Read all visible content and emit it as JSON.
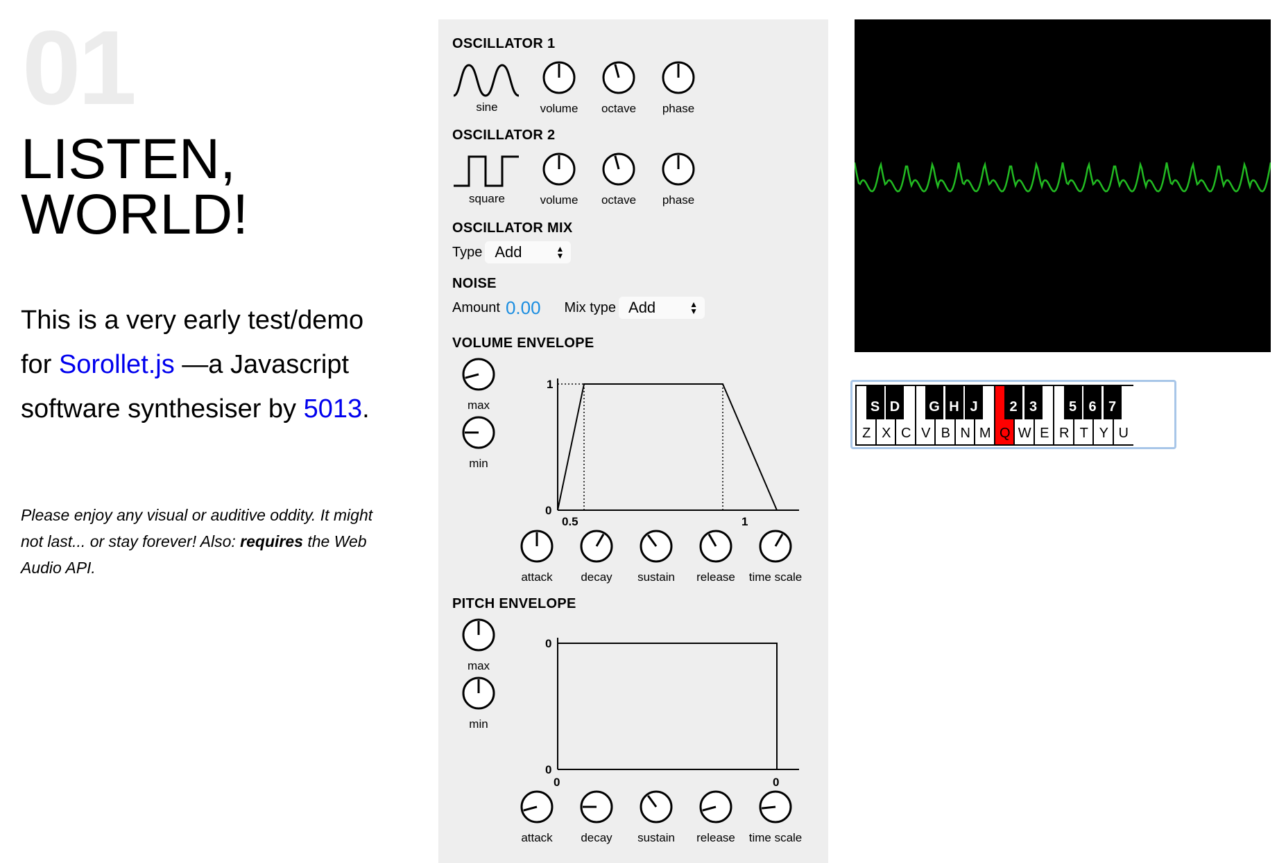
{
  "hero": {
    "number": "01",
    "title_line1": "LISTEN,",
    "title_line2": "WORLD!"
  },
  "intro": {
    "text1": "This is a very early test/demo for ",
    "link1": "Sorollet.js",
    "text2": " —a Javascript software synthesiser by ",
    "link2": "5013",
    "text3": "."
  },
  "note": {
    "text1": "Please enjoy any visual or auditive oddity. It might not last... or stay forever! Also: ",
    "bold": "requires",
    "text2": " the Web Audio API."
  },
  "osc1": {
    "title": "OSCILLATOR 1",
    "wave_label": "sine",
    "knobs": [
      {
        "label": "volume",
        "value": 0.5
      },
      {
        "label": "octave",
        "value": 0.45
      },
      {
        "label": "phase",
        "value": 0.5
      }
    ]
  },
  "osc2": {
    "title": "OSCILLATOR 2",
    "wave_label": "square",
    "knobs": [
      {
        "label": "volume",
        "value": 0.5
      },
      {
        "label": "octave",
        "value": 0.45
      },
      {
        "label": "phase",
        "value": 0.5
      }
    ]
  },
  "mix": {
    "title": "OSCILLATOR MIX",
    "type_label": "Type",
    "type_value": "Add"
  },
  "noise": {
    "title": "NOISE",
    "amount_label": "Amount",
    "amount_value": "0.00",
    "mix_type_label": "Mix type",
    "mix_type_value": "Add"
  },
  "volume_envelope": {
    "title": "VOLUME ENVELOPE",
    "range_knobs": [
      {
        "label": "max",
        "value": 0.15
      },
      {
        "label": "min",
        "value": 0.2
      }
    ],
    "y_top_label": "1",
    "y_bottom_label": "0",
    "x_left_label": "0.5",
    "x_right_label": "1",
    "knobs": [
      {
        "label": "attack",
        "value": 0.5
      },
      {
        "label": "decay",
        "value": 0.6
      },
      {
        "label": "sustain",
        "value": 0.38
      },
      {
        "label": "release",
        "value": 0.4
      },
      {
        "label": "time scale",
        "value": 0.6
      }
    ]
  },
  "pitch_envelope": {
    "title": "PITCH ENVELOPE",
    "range_knobs": [
      {
        "label": "max",
        "value": 0.5
      },
      {
        "label": "min",
        "value": 0.5
      }
    ],
    "y_top_label": "0",
    "y_bottom_label": "0",
    "x_left_label": "0",
    "x_right_label": "0",
    "knobs": [
      {
        "label": "attack",
        "value": 0.15
      },
      {
        "label": "decay",
        "value": 0.2
      },
      {
        "label": "sustain",
        "value": 0.38
      },
      {
        "label": "release",
        "value": 0.15
      },
      {
        "label": "time scale",
        "value": 0.18
      }
    ]
  },
  "keyboard": {
    "white_keys": [
      "Z",
      "X",
      "C",
      "V",
      "B",
      "N",
      "M",
      "Q",
      "W",
      "E",
      "R",
      "T",
      "Y",
      "U"
    ],
    "black_keys": [
      {
        "label": "S",
        "after": 0
      },
      {
        "label": "D",
        "after": 1
      },
      {
        "label": "G",
        "after": 3
      },
      {
        "label": "H",
        "after": 4
      },
      {
        "label": "J",
        "after": 5
      },
      {
        "label": "2",
        "after": 7
      },
      {
        "label": "3",
        "after": 8
      },
      {
        "label": "5",
        "after": 10
      },
      {
        "label": "6",
        "after": 11
      },
      {
        "label": "7",
        "after": 12
      }
    ],
    "active_key": "Q"
  },
  "colors": {
    "link": "#0000ee",
    "amount": "#1a8de0",
    "scope_wave": "#22bb22",
    "active_key": "#ff0000"
  }
}
